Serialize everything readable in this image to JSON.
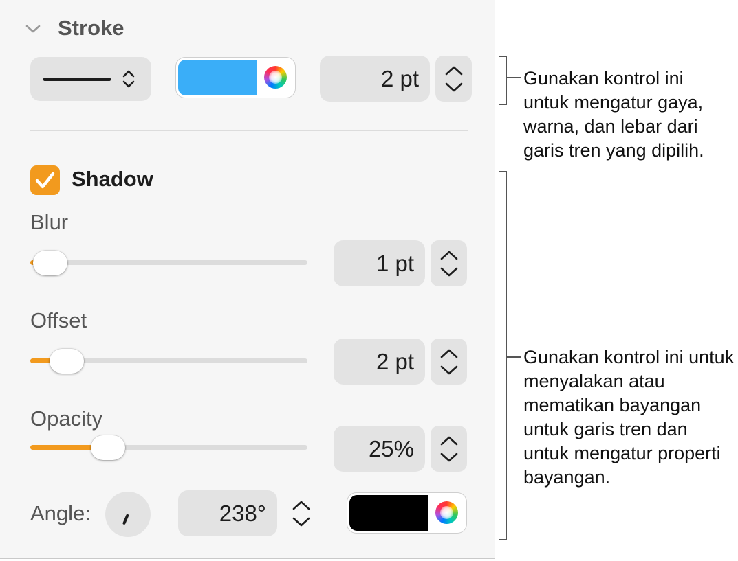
{
  "stroke": {
    "title": "Stroke",
    "style_icon": "solid-line",
    "color": "#3aaef8",
    "width_value": "2 pt"
  },
  "shadow": {
    "title": "Shadow",
    "enabled": true,
    "blur": {
      "label": "Blur",
      "value": "1 pt",
      "level": 0.01
    },
    "offset": {
      "label": "Offset",
      "value": "2 pt",
      "level": 0.08
    },
    "opacity": {
      "label": "Opacity",
      "value": "25%",
      "level": 0.25
    },
    "angle": {
      "label": "Angle:",
      "value": "238°",
      "degrees": 238
    },
    "color": "#000000"
  },
  "callouts": {
    "stroke": "Gunakan kontrol ini untuk mengatur gaya, warna, dan lebar dari garis tren yang dipilih.",
    "shadow": "Gunakan kontrol ini untuk menyalakan atau mematikan bayangan untuk garis tren dan untuk mengatur properti bayangan."
  },
  "colors": {
    "accent": "#f29a1e"
  }
}
